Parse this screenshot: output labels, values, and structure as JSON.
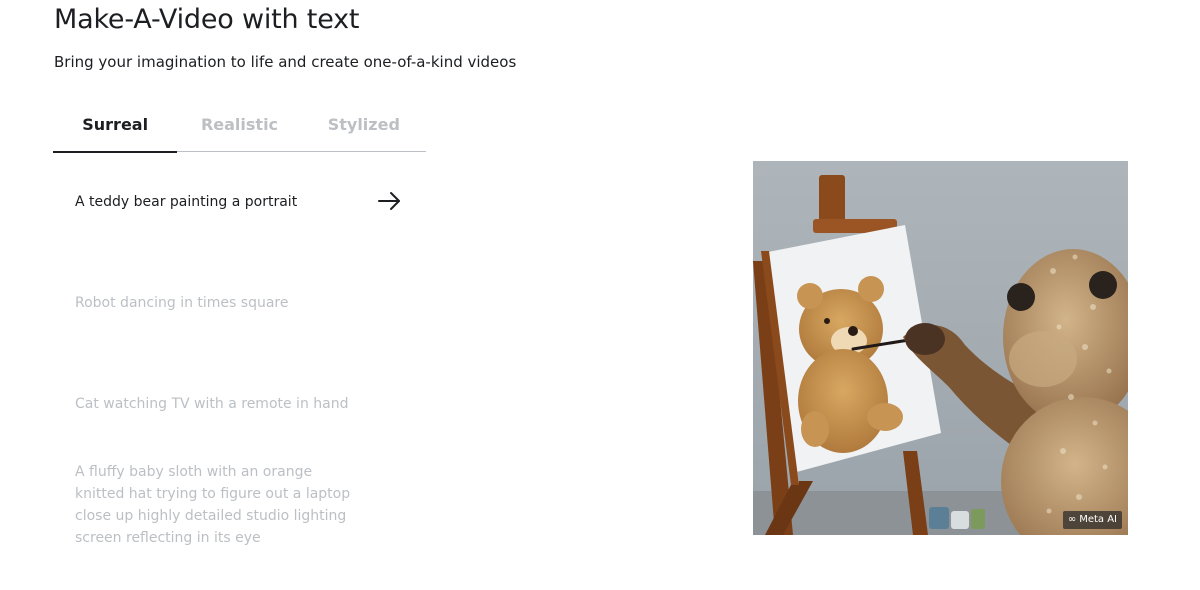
{
  "header": {
    "title": "Make-A-Video with text",
    "subtitle": "Bring your imagination to life and create one-of-a-kind videos"
  },
  "tabs": [
    {
      "label": "Surreal",
      "active": true
    },
    {
      "label": "Realistic",
      "active": false
    },
    {
      "label": "Stylized",
      "active": false
    }
  ],
  "prompts": [
    {
      "text": "A teddy bear painting a portrait",
      "active": true
    },
    {
      "text": "Robot dancing in times square",
      "active": false
    },
    {
      "text": "Cat watching TV with a remote in hand",
      "active": false
    },
    {
      "text": "A fluffy baby sloth with an orange knitted hat trying to figure out a laptop close up highly detailed studio lighting screen reflecting in its eye",
      "active": false
    }
  ],
  "icons": {
    "prompt_arrow": "arrow-right-icon",
    "watermark_logo": "meta-logo-icon"
  },
  "video": {
    "watermark": "Meta AI"
  },
  "colors": {
    "active_text": "#1c1e21",
    "inactive_text": "#bcc0c4",
    "tab_underline": "#1c1e21",
    "tab_divider": "#bcc0c4"
  }
}
